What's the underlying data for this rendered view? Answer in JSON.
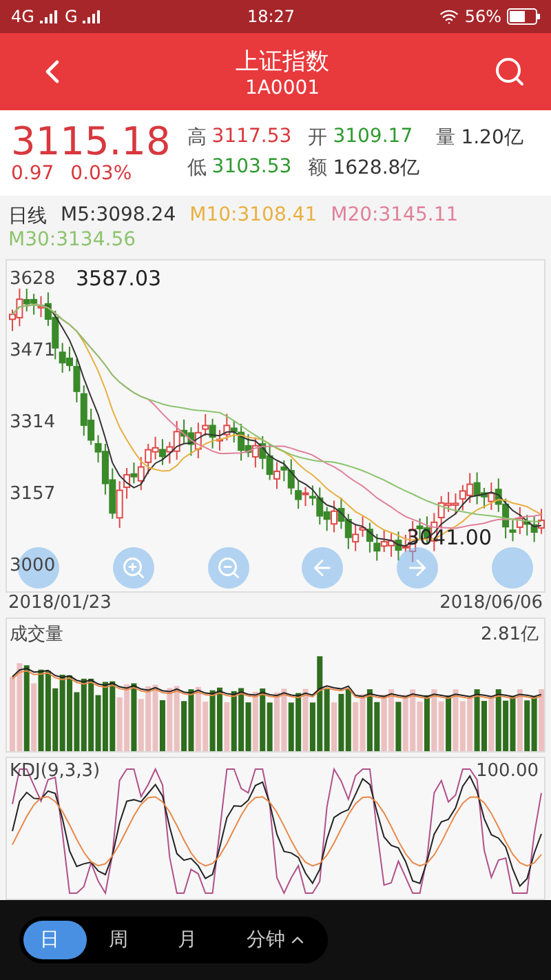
{
  "status_bar": {
    "network_1": "4G",
    "network_2": "G",
    "time": "18:27",
    "battery": "56%"
  },
  "header": {
    "title": "上证指数",
    "code": "1A0001"
  },
  "quote": {
    "price": "3115.18",
    "change": "0.97",
    "change_pct": "0.03%",
    "stats": [
      {
        "label": "高",
        "value": "3117.53",
        "color": "#d8383e"
      },
      {
        "label": "开",
        "value": "3109.17",
        "color": "#2f9a2f"
      },
      {
        "label": "量",
        "value": "1.20亿",
        "color": "#333333"
      },
      {
        "label": "低",
        "value": "3103.53",
        "color": "#2f9a2f"
      },
      {
        "label": "额",
        "value": "1628.8亿",
        "color": "#333333"
      }
    ]
  },
  "ma_legend": {
    "period": "日线",
    "items": [
      {
        "label": "M5:3098.24",
        "color": "#333333"
      },
      {
        "label": "M10:3108.41",
        "color": "#e8b040"
      },
      {
        "label": "M20:3145.11",
        "color": "#e0809a"
      },
      {
        "label": "M30:3134.56",
        "color": "#8cc46e"
      }
    ]
  },
  "price_chart": {
    "y_labels": [
      "3628",
      "3471",
      "3314",
      "3157",
      "3000"
    ],
    "high_label": "3587.03",
    "low_label": "3041.00",
    "start_date": "2018/01/23",
    "end_date": "2018/06/06"
  },
  "volume_chart": {
    "title": "成交量",
    "max_label": "2.81亿"
  },
  "kdj_chart": {
    "title": "KDJ(9,3,3)",
    "max_label": "100.00"
  },
  "period_tabs": [
    {
      "label": "日",
      "selected": true,
      "kind": "tab"
    },
    {
      "label": "周",
      "selected": false,
      "kind": "tab"
    },
    {
      "label": "月",
      "selected": false,
      "kind": "tab"
    },
    {
      "label": "分钟",
      "selected": false,
      "kind": "menu"
    }
  ]
}
